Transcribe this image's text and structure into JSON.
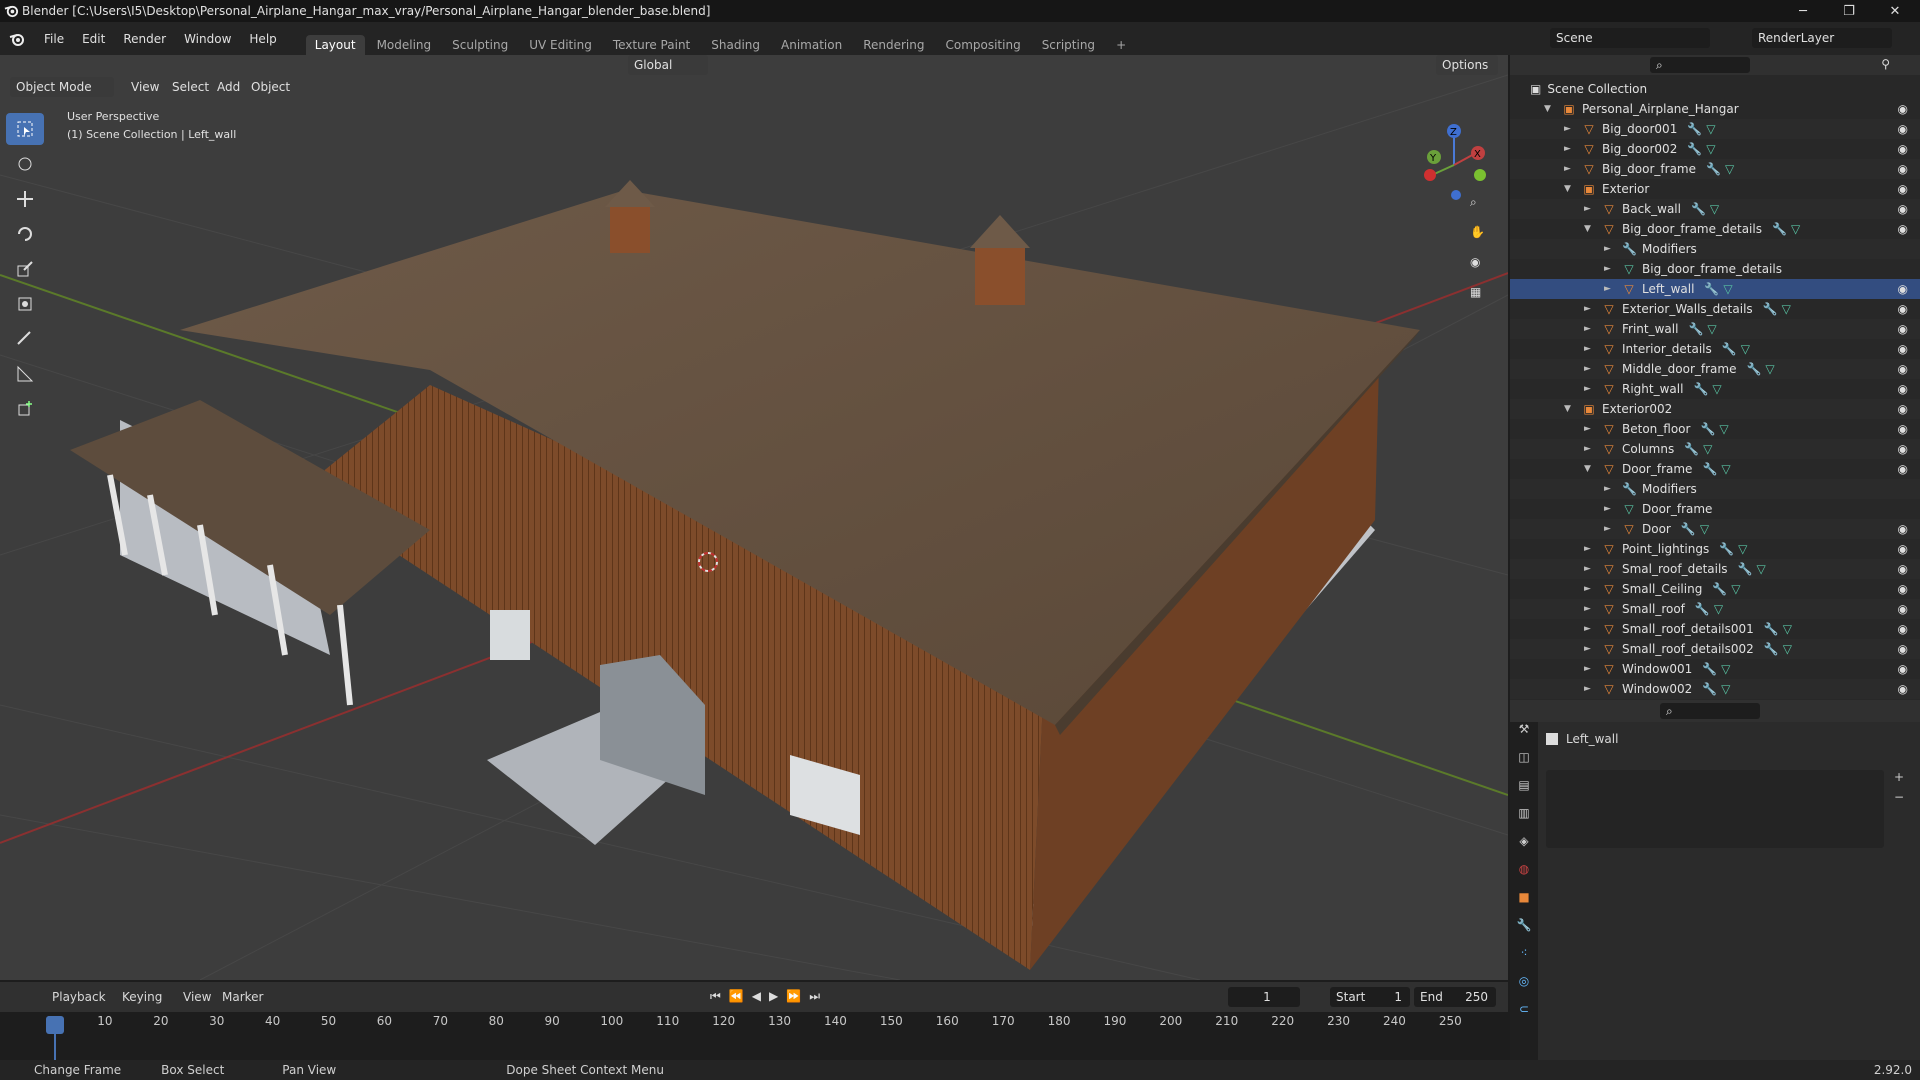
{
  "window": {
    "title": "Blender [C:\\Users\\I5\\Desktop\\Personal_Airplane_Hangar_max_vray/Personal_Airplane_Hangar_blender_base.blend]",
    "min": "─",
    "max": "❐",
    "close": "✕"
  },
  "menu": [
    "File",
    "Edit",
    "Render",
    "Window",
    "Help"
  ],
  "workspaces": [
    "Layout",
    "Modeling",
    "Sculpting",
    "UV Editing",
    "Texture Paint",
    "Shading",
    "Animation",
    "Rendering",
    "Compositing",
    "Scripting"
  ],
  "active_workspace": "Layout",
  "scene": {
    "label": "Scene",
    "render_layer": "RenderLayer"
  },
  "viewport": {
    "transform_orientation": "Global",
    "options_label": "Options",
    "mode": "Object Mode",
    "menus": [
      "View",
      "Select",
      "Add",
      "Object"
    ],
    "perspective": "User Perspective",
    "collection_info": "(1) Scene Collection | Left_wall"
  },
  "gizmo": {
    "z": "Z",
    "y": "Y",
    "x": "X"
  },
  "outliner": {
    "root": "Scene Collection",
    "rows": [
      {
        "label": "Personal_Airplane_Hangar",
        "level": 1,
        "type": "collection",
        "expanded": true
      },
      {
        "label": "Big_door001",
        "level": 2,
        "type": "object"
      },
      {
        "label": "Big_door002",
        "level": 2,
        "type": "object"
      },
      {
        "label": "Big_door_frame",
        "level": 2,
        "type": "object"
      },
      {
        "label": "Exterior",
        "level": 2,
        "type": "collection",
        "expanded": true
      },
      {
        "label": "Back_wall",
        "level": 3,
        "type": "object"
      },
      {
        "label": "Big_door_frame_details",
        "level": 3,
        "type": "object",
        "expanded": true
      },
      {
        "label": "Modifiers",
        "level": 4,
        "type": "modifiers"
      },
      {
        "label": "Big_door_frame_details",
        "level": 4,
        "type": "mesh"
      },
      {
        "label": "Left_wall",
        "level": 4,
        "type": "object",
        "selected": true
      },
      {
        "label": "Exterior_Walls_details",
        "level": 3,
        "type": "object"
      },
      {
        "label": "Frint_wall",
        "level": 3,
        "type": "object"
      },
      {
        "label": "Interior_details",
        "level": 3,
        "type": "object"
      },
      {
        "label": "Middle_door_frame",
        "level": 3,
        "type": "object"
      },
      {
        "label": "Right_wall",
        "level": 3,
        "type": "object"
      },
      {
        "label": "Exterior002",
        "level": 2,
        "type": "collection",
        "expanded": true
      },
      {
        "label": "Beton_floor",
        "level": 3,
        "type": "object"
      },
      {
        "label": "Columns",
        "level": 3,
        "type": "object"
      },
      {
        "label": "Door_frame",
        "level": 3,
        "type": "object",
        "expanded": true
      },
      {
        "label": "Modifiers",
        "level": 4,
        "type": "modifiers"
      },
      {
        "label": "Door_frame",
        "level": 4,
        "type": "mesh"
      },
      {
        "label": "Door",
        "level": 4,
        "type": "object"
      },
      {
        "label": "Point_lightings",
        "level": 3,
        "type": "object"
      },
      {
        "label": "Smal_roof_details",
        "level": 3,
        "type": "object"
      },
      {
        "label": "Small_Ceiling",
        "level": 3,
        "type": "object"
      },
      {
        "label": "Small_roof",
        "level": 3,
        "type": "object"
      },
      {
        "label": "Small_roof_details001",
        "level": 3,
        "type": "object"
      },
      {
        "label": "Small_roof_details002",
        "level": 3,
        "type": "object"
      },
      {
        "label": "Window001",
        "level": 3,
        "type": "object"
      },
      {
        "label": "Window002",
        "level": 3,
        "type": "object"
      }
    ]
  },
  "properties": {
    "object_name": "Left_wall"
  },
  "timeline": {
    "menus": [
      "Playback",
      "Keying",
      "View",
      "Marker"
    ],
    "current_frame": "1",
    "start_label": "Start",
    "start": "1",
    "end_label": "End",
    "end": "250",
    "ticks": [
      "1",
      "10",
      "20",
      "30",
      "40",
      "50",
      "60",
      "70",
      "80",
      "90",
      "100",
      "110",
      "120",
      "130",
      "140",
      "150",
      "160",
      "170",
      "180",
      "190",
      "200",
      "210",
      "220",
      "230",
      "240",
      "250"
    ]
  },
  "status": {
    "change_frame": "Change Frame",
    "box_select": "Box Select",
    "pan_view": "Pan View",
    "context_menu": "Dope Sheet Context Menu",
    "version": "2.92.0"
  },
  "colors": {
    "accent": "#4772b3",
    "orange_object": "#e8883a",
    "mesh_green": "#58c2a3"
  }
}
